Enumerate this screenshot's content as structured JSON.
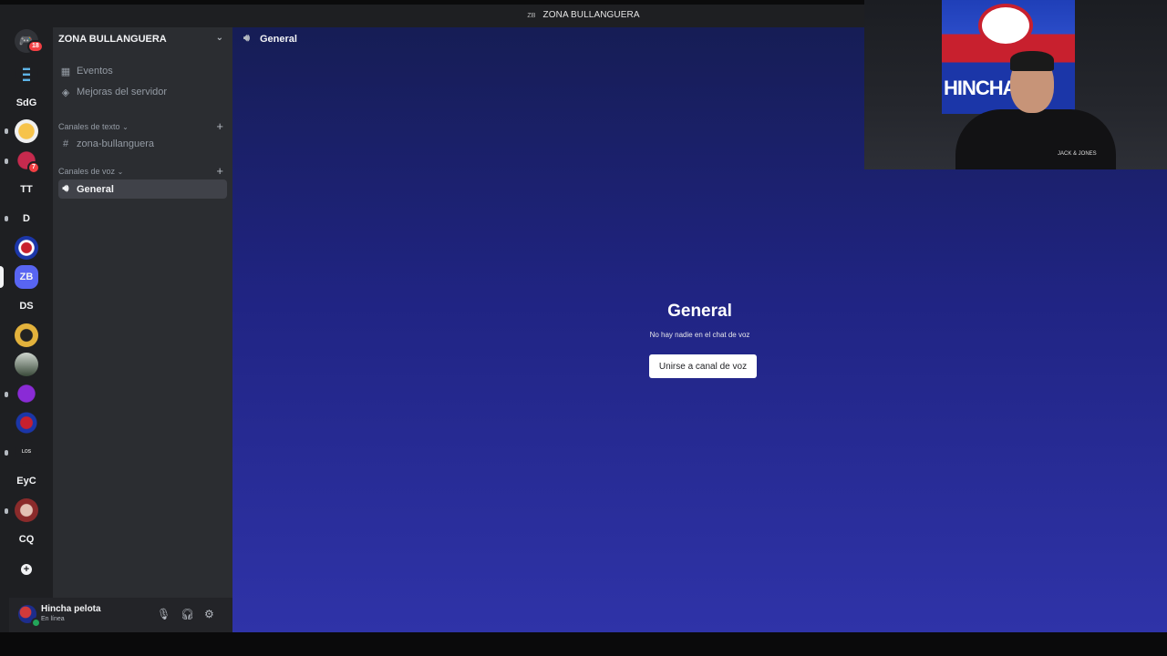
{
  "titlebar": {
    "server_icon_text": "ZB",
    "title": "ZONA BULLANGUERA",
    "download_icon": "download-icon",
    "minimize": "─",
    "maximize": "☐",
    "close": "✕"
  },
  "rail": {
    "home_badge": "18",
    "items": [
      {
        "label": "SdG"
      },
      {
        "label": "TT"
      },
      {
        "label": "D"
      },
      {
        "label": "ZB"
      },
      {
        "label": "DS"
      },
      {
        "label": "EyC"
      },
      {
        "label": "CQ"
      }
    ],
    "badge2": "7",
    "add_server": "+"
  },
  "sidebar": {
    "guild_name": "ZONA BULLANGUERA",
    "events_label": "Eventos",
    "boosts_label": "Mejoras del servidor",
    "text_category": "Canales de texto",
    "text_channel": "zona-bullanguera",
    "voice_category": "Canales de voz",
    "voice_channel": "General"
  },
  "user": {
    "name": "Hincha pelota",
    "status": "En línea"
  },
  "main": {
    "header_title": "General",
    "voice_title": "General",
    "voice_subtitle": "No hay nadie en el chat de voz",
    "join_button": "Unirse a canal de voz"
  },
  "webcam": {
    "flag_text": "HINCHA",
    "shirt_text": "JACK & JONES"
  },
  "colors": {
    "rail_bg": "#1e1f22",
    "sidebar_bg": "#2b2d31",
    "accent": "#5865f2",
    "main_gradient_top": "#161d55",
    "main_gradient_bottom": "#2f33a8"
  }
}
